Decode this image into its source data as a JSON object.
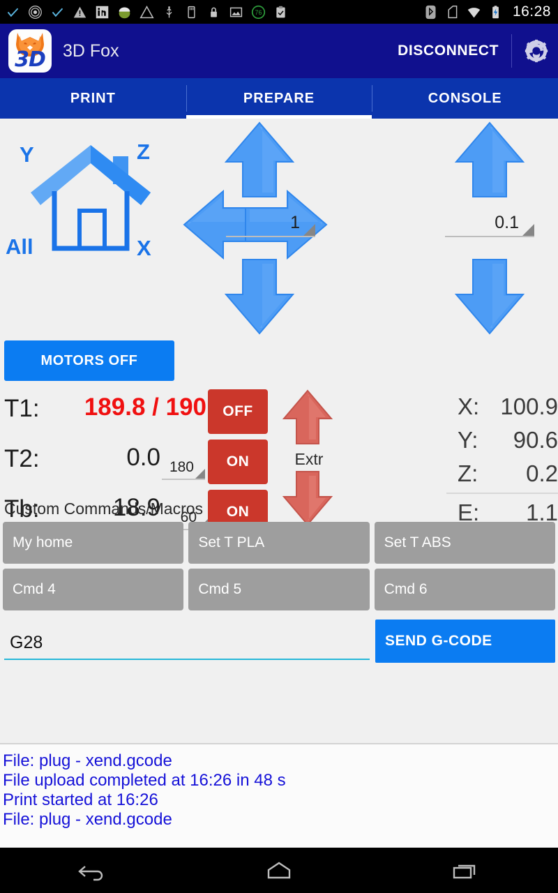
{
  "statusbar": {
    "icons": [
      "check-icon",
      "record-icon",
      "check-icon",
      "warning-icon",
      "linkedin-icon",
      "download-icon",
      "warning-triangle-icon",
      "usb-icon",
      "sdcard-icon",
      "lock-icon",
      "image-icon",
      "battery-count-icon",
      "clipboard-icon"
    ],
    "battery_count": "76",
    "right_icons": [
      "bluetooth-icon",
      "sim-icon",
      "wifi-icon",
      "battery-charging-icon"
    ],
    "clock": "16:28"
  },
  "appbar": {
    "logo_text": "3D",
    "title": "3D Fox",
    "disconnect_label": "DISCONNECT",
    "settings_icon": "gear-icon"
  },
  "tabs": [
    {
      "label": "PRINT",
      "selected": false
    },
    {
      "label": "PREPARE",
      "selected": true
    },
    {
      "label": "CONSOLE",
      "selected": false
    }
  ],
  "home": {
    "icon": "house-icon",
    "y_label": "Y",
    "z_label": "Z",
    "all_label": "All",
    "x_label": "X"
  },
  "jog": {
    "xy_step": "1",
    "z_step": "0.1"
  },
  "motors": {
    "label": "MOTORS OFF"
  },
  "temperatures": [
    {
      "name": "T1:",
      "value": "189.8 / 190",
      "hot": true,
      "setpoint": null,
      "button": "OFF"
    },
    {
      "name": "T2:",
      "value": "0.0",
      "hot": false,
      "setpoint": "180",
      "button": "ON"
    },
    {
      "name": "Tb:",
      "value": "18.9",
      "hot": false,
      "setpoint": "60",
      "button": "ON"
    }
  ],
  "extruder": {
    "label": "Extr",
    "up_icon": "arrow-up-icon",
    "down_icon": "arrow-down-icon"
  },
  "position": [
    {
      "key": "X:",
      "value": "100.9"
    },
    {
      "key": "Y:",
      "value": "90.6"
    },
    {
      "key": "Z:",
      "value": "0.2"
    },
    {
      "key": "E:",
      "value": "1.1"
    }
  ],
  "macros": {
    "title": "Custom Commands/Macros",
    "buttons": [
      "My home",
      "Set T PLA",
      "Set T ABS",
      "Cmd 4",
      "Cmd 5",
      "Cmd 6"
    ]
  },
  "gcode": {
    "value": "G28",
    "send_label": "SEND G-CODE"
  },
  "log": {
    "lines": [
      "File: plug - xend.gcode",
      "File upload completed at 16:26 in 48 s",
      "Print started at 16:26",
      "File: plug - xend.gcode"
    ]
  },
  "navbar": [
    "back-icon",
    "home-icon",
    "recents-icon"
  ],
  "colors": {
    "appbar": "#10108e",
    "tabbar": "#0b34ad",
    "accent_blue": "#0b7cf2",
    "hot_red": "#f01010",
    "button_red": "#cb372b",
    "macro_grey": "#9e9e9e",
    "log_blue": "#1511d8",
    "arrow_blue": "#3f94f2",
    "arrow_red": "#d9665c",
    "field_underline": "#26b7d8"
  }
}
